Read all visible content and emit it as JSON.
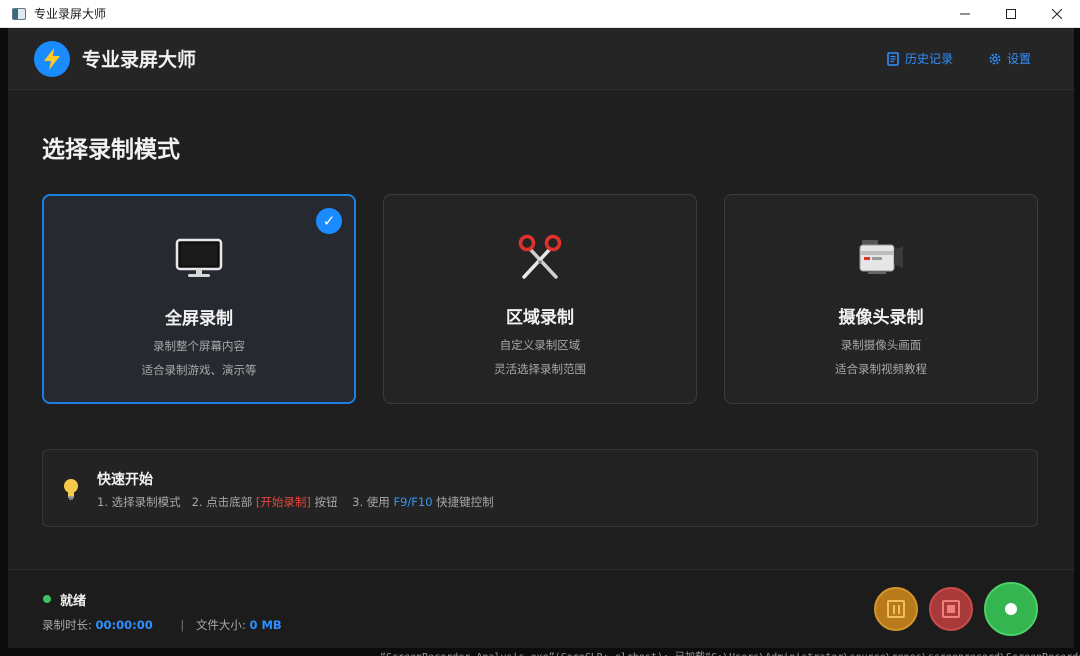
{
  "window": {
    "title": "专业录屏大师",
    "controls": [
      "minimize",
      "maximize",
      "close"
    ]
  },
  "header": {
    "app_name": "专业录屏大师",
    "history_label": "历史记录",
    "settings_label": "设置"
  },
  "main": {
    "section_title": "选择录制模式",
    "modes": [
      {
        "title": "全屏录制",
        "desc1": "录制整个屏幕内容",
        "desc2": "适合录制游戏、演示等",
        "icon": "monitor-icon",
        "selected": true
      },
      {
        "title": "区域录制",
        "desc1": "自定义录制区域",
        "desc2": "灵活选择录制范围",
        "icon": "scissors-icon",
        "selected": false
      },
      {
        "title": "摄像头录制",
        "desc1": "录制摄像头画面",
        "desc2": "适合录制视频教程",
        "icon": "camera-icon",
        "selected": false
      }
    ],
    "quick_start": {
      "title": "快速开始",
      "step1": "1. 选择录制模式",
      "step2_prefix": "2. 点击底部 ",
      "step2_highlight": "[开始录制]",
      "step2_suffix": " 按钮",
      "step3_prefix": "3. 使用 ",
      "step3_highlight": "F9/F10",
      "step3_suffix": " 快捷键控制"
    }
  },
  "footer": {
    "status": "就绪",
    "duration_label": "录制时长:",
    "duration_value": "00:00:00",
    "sep": "|",
    "size_label": "文件大小:",
    "size_value": "0 MB"
  },
  "colors": {
    "accent": "#1a8cff",
    "pause": "#b87a1a",
    "stop": "#a83a3a",
    "record": "#34b54f",
    "status_ready": "#3cc160"
  },
  "background_terminal": {
    "text": "“ScreenRecorder.Analysis.exe”(CoreCLR: clrhost): 已加载“C:\\Users\\Administrator\\source\\repos\\screenrecord\\ScreenRecorder.Analysis"
  }
}
